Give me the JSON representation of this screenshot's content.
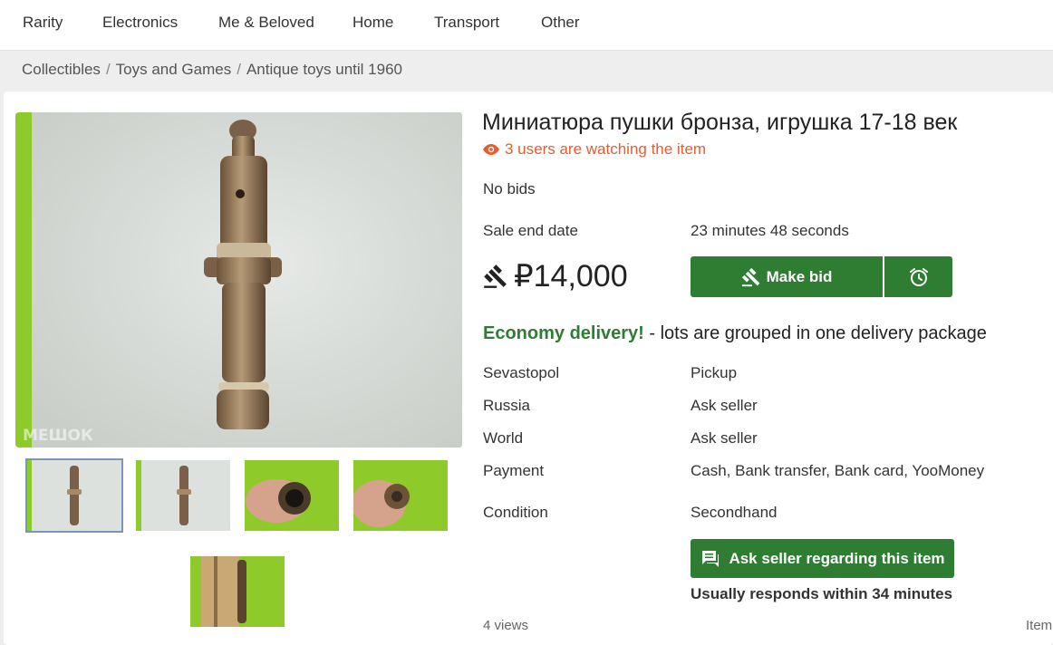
{
  "nav": {
    "items": [
      "Rarity",
      "Electronics",
      "Me & Beloved",
      "Home",
      "Transport",
      "Other"
    ]
  },
  "breadcrumb": [
    "Collectibles",
    "Toys and Games",
    "Antique toys until 1960"
  ],
  "gallery": {
    "watermark": "МЕШОК",
    "thumbnails": [
      "thumb-1",
      "thumb-2",
      "thumb-3",
      "thumb-4",
      "thumb-5"
    ]
  },
  "lot": {
    "title": "Миниатюра пушки бронза, игрушка 17-18 век",
    "watching": "3 users are watching the item",
    "bids": "No bids",
    "sale_end_label": "Sale end date",
    "sale_end_value": "23 minutes 48 seconds",
    "price": "₽14,000",
    "make_bid_label": "Make bid",
    "delivery_highlight": "Economy delivery!",
    "delivery_rest": " - lots are grouped in one delivery package",
    "details": [
      {
        "label": "Sevastopol",
        "value": "Pickup"
      },
      {
        "label": "Russia",
        "value": "Ask seller"
      },
      {
        "label": "World",
        "value": "Ask seller"
      },
      {
        "label": "Payment",
        "value": "Cash, Bank transfer, Bank card, YooMoney"
      },
      {
        "label": "Condition",
        "value": "Secondhand"
      }
    ],
    "ask_seller_label": "Ask seller regarding this item",
    "responds": "Usually responds within 34 minutes",
    "views": "4 views",
    "item_cut": "Item"
  },
  "colors": {
    "accent_green": "#2f7d32",
    "watch_orange": "#e65c2e",
    "thumb_active_border": "#7a97b8"
  }
}
